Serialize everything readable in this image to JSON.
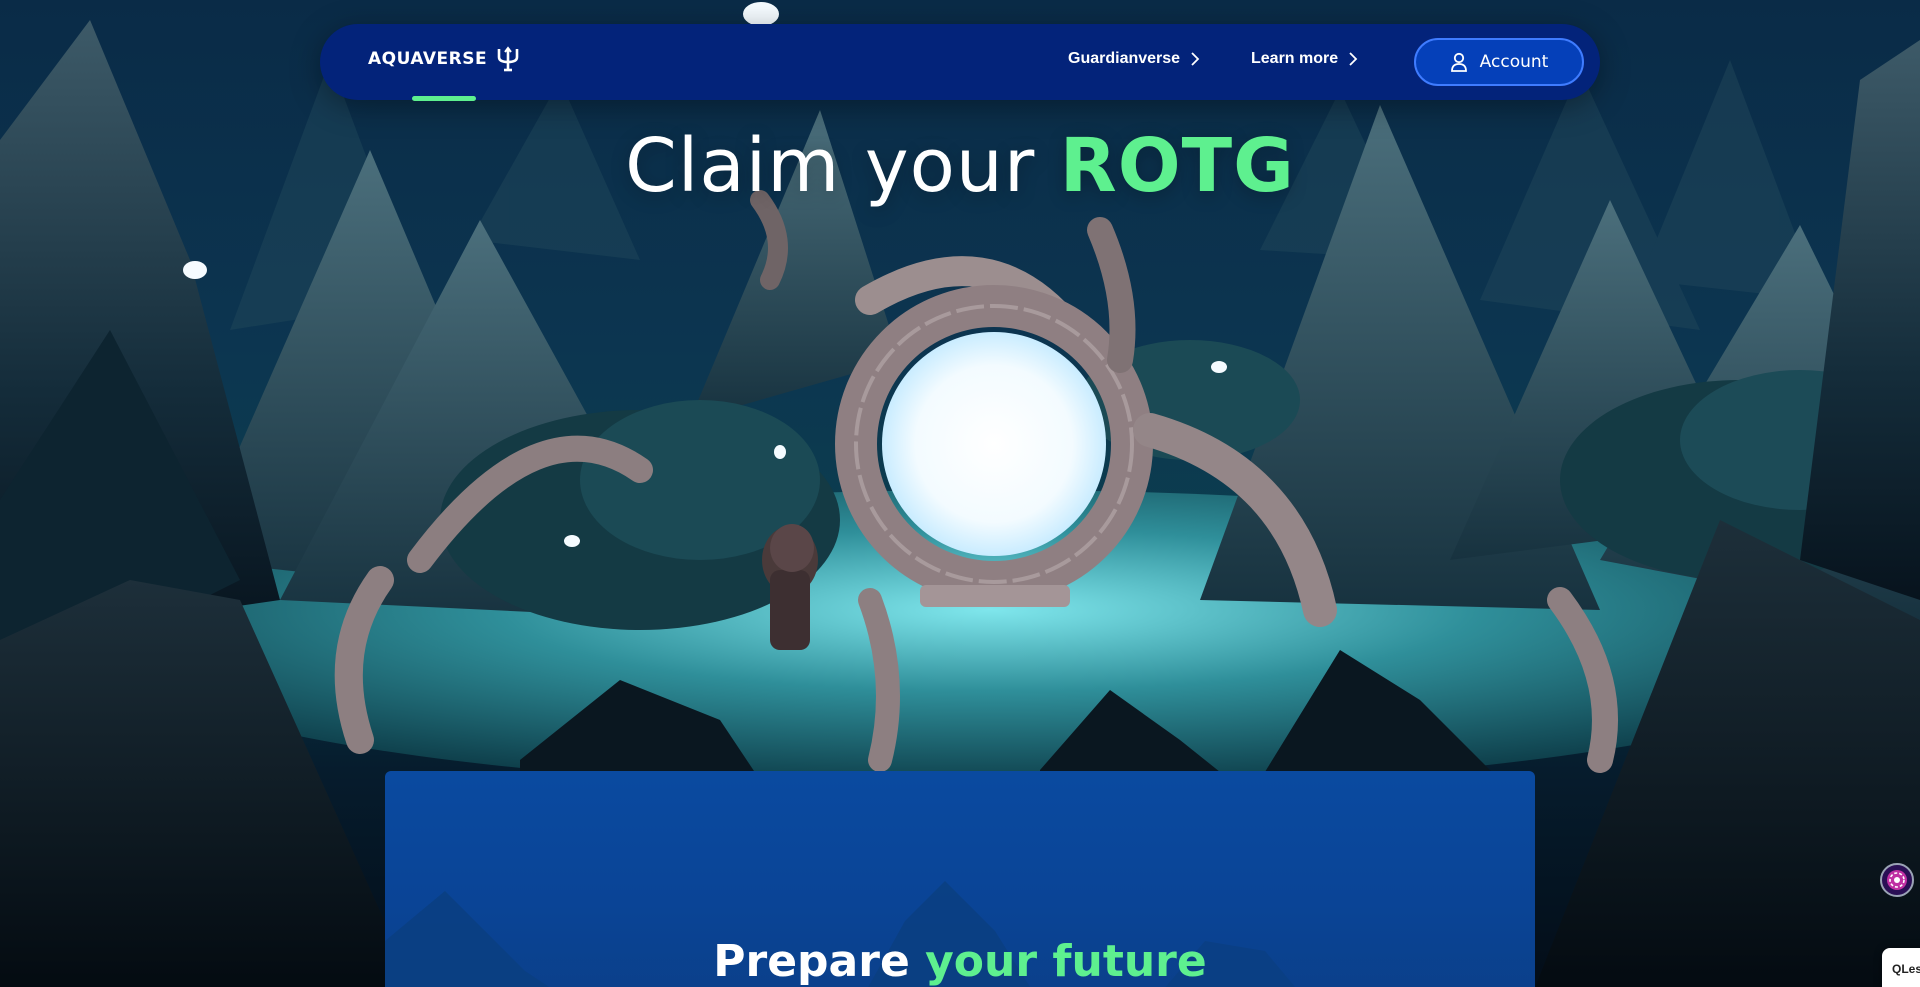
{
  "brand": {
    "name": "AQUAVERSE",
    "logo_icon": "trident-icon"
  },
  "nav": {
    "links": [
      {
        "label": "Guardianverse",
        "icon": "chevron-right-icon"
      },
      {
        "label": "Learn more",
        "icon": "chevron-right-icon"
      }
    ],
    "account_label": "Account",
    "account_icon": "user-icon"
  },
  "hero": {
    "title_prefix": "Claim your ",
    "title_accent": "ROTG"
  },
  "panel": {
    "title_prefix": "Prepare ",
    "title_accent": "your future"
  },
  "widgets": {
    "side_icon": "gear-flower-icon",
    "chat_label": "QLes"
  },
  "colors": {
    "nav_bg": "#03237a",
    "accent_green": "#5ef08f",
    "account_bg": "#0540b9",
    "panel_bg": "#0a4aa0"
  }
}
